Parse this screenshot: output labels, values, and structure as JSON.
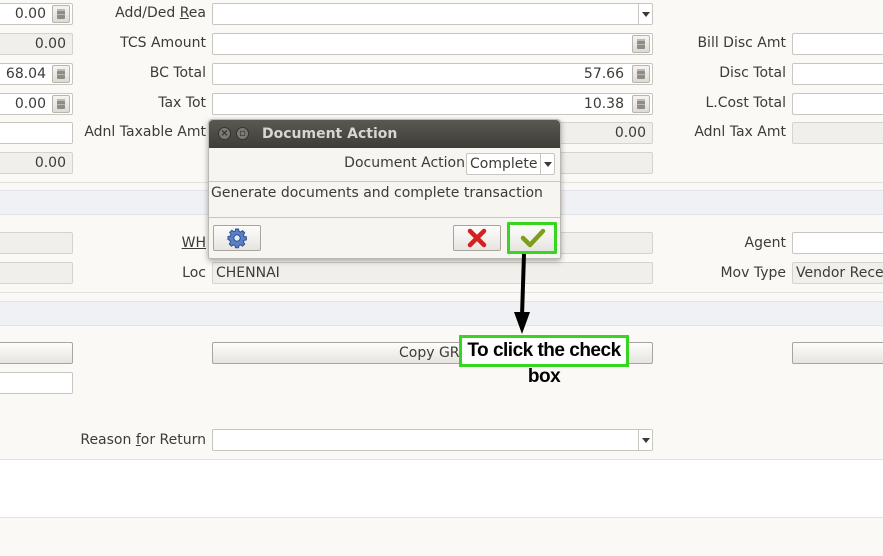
{
  "form": {
    "add_ded_rea_label": "Add/Ded Rea",
    "tcs_amount_label": "TCS Amount",
    "bc_total_label": "BC Total",
    "tax_tot_label": "Tax Tot",
    "adnl_taxable_amt_label": "Adnl Taxable Amt",
    "bill_disc_amt_label": "Bill Disc Amt",
    "disc_total_label": "Disc Total",
    "lcost_total_label": "L.Cost Total",
    "adnl_tax_amt_label": "Adnl Tax Amt",
    "wh_label": "WH",
    "loc_label": "Loc",
    "agent_label": "Agent",
    "mov_type_label": "Mov Type",
    "reason_for_return_label": "Reason for Return",
    "left_col_values": [
      "0.00",
      "0.00",
      "68.04",
      "0.00",
      "",
      "0.00"
    ],
    "bc_total_value": "57.66",
    "tax_tot_value": "10.38",
    "adnl_taxable_amt_value": "0.00",
    "loc_value": "CHENNAI",
    "mov_type_value": "Vendor Rece",
    "copy_grn_label": "Copy GRN"
  },
  "dialog": {
    "title": "Document Action",
    "action_label": "Document Action",
    "action_value": "Complete",
    "description": "Generate documents and complete transaction"
  },
  "annotation": {
    "text": "To click the check box",
    "color": "#35d61f"
  }
}
